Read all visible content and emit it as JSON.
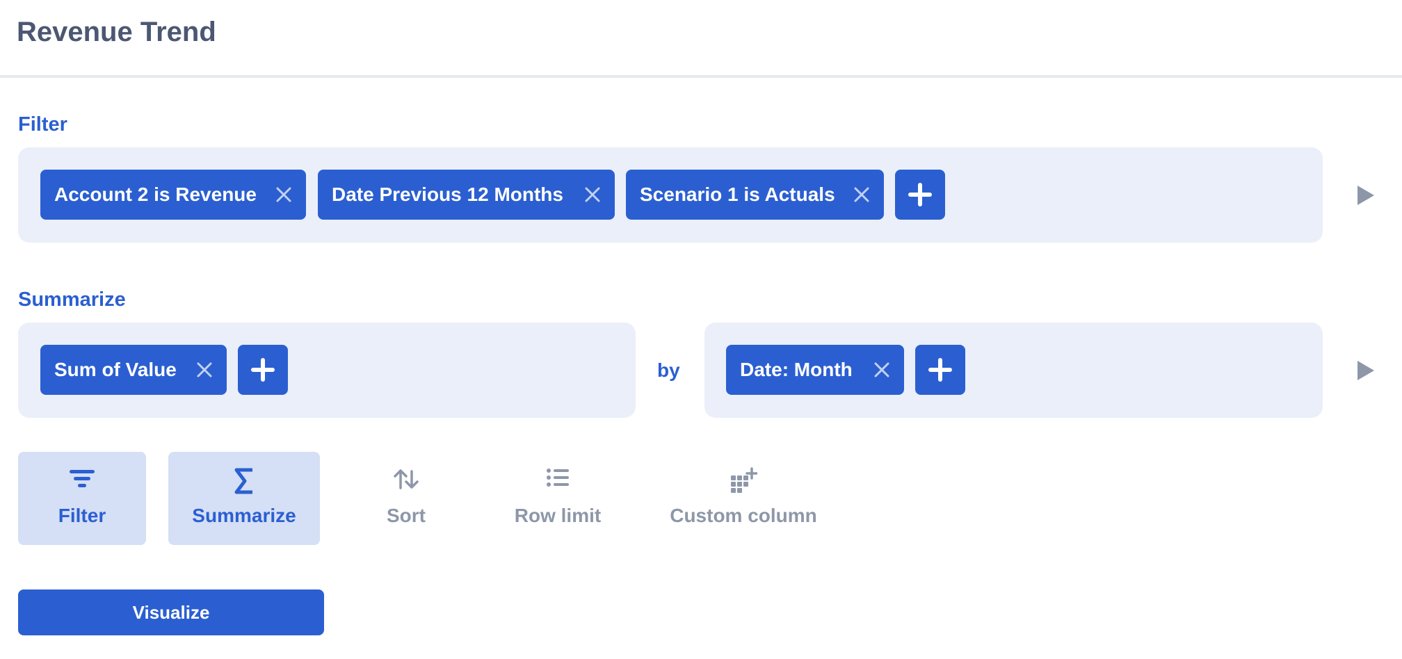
{
  "page": {
    "title": "Revenue Trend"
  },
  "filter": {
    "label": "Filter",
    "chips": [
      {
        "label": "Account 2 is Revenue"
      },
      {
        "label": "Date Previous 12 Months"
      },
      {
        "label": "Scenario 1 is Actuals"
      }
    ]
  },
  "summarize": {
    "label": "Summarize",
    "metrics": [
      {
        "label": "Sum of Value"
      }
    ],
    "by_label": "by",
    "groupings": [
      {
        "label": "Date: Month"
      }
    ]
  },
  "actions": [
    {
      "label": "Filter",
      "icon": "filter-icon",
      "active": true
    },
    {
      "label": "Summarize",
      "icon": "sigma-icon",
      "active": true
    },
    {
      "label": "Sort",
      "icon": "sort-icon",
      "active": false
    },
    {
      "label": "Row limit",
      "icon": "list-icon",
      "active": false
    },
    {
      "label": "Custom column",
      "icon": "add-column-icon",
      "active": false
    }
  ],
  "visualize_button": {
    "label": "Visualize"
  },
  "colors": {
    "brand": "#2b5fd1",
    "panel_background": "#eaeff9",
    "active_action_background": "#d5dff5",
    "inactive_text": "#8d97a8",
    "title_text": "#4c5773"
  }
}
